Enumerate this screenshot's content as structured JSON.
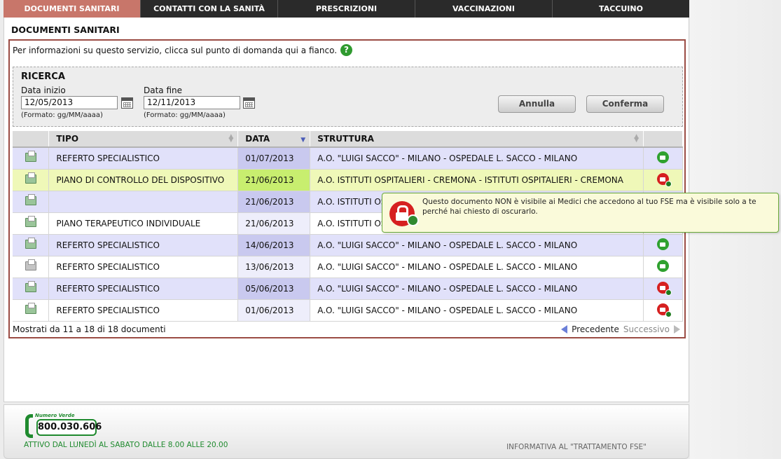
{
  "nav": {
    "tabs": [
      "DOCUMENTI SANITARI",
      "CONTATTI CON LA SANITÀ",
      "PRESCRIZIONI",
      "VACCINAZIONI",
      "TACCUINO"
    ]
  },
  "page": {
    "title": "DOCUMENTI SANITARI",
    "info_text": "Per informazioni su questo servizio, clicca sul punto di domanda qui a fianco."
  },
  "search": {
    "title": "RICERCA",
    "start_label": "Data inizio",
    "start_value": "12/05/2013",
    "start_format": "(Formato: gg/MM/aaaa)",
    "end_label": "Data fine",
    "end_value": "12/11/2013",
    "end_format": "(Formato: gg/MM/aaaa)",
    "cancel_label": "Annulla",
    "confirm_label": "Conferma"
  },
  "table": {
    "headers": [
      "",
      "TIPO",
      "DATA",
      "STRUTTURA",
      ""
    ],
    "rows": [
      {
        "tipo": "REFERTO SPECIALISTICO",
        "data": "01/07/2013",
        "struttura": "A.O. \"LUIGI SACCO\" - MILANO - OSPEDALE L. SACCO - MILANO"
      },
      {
        "tipo": "PIANO DI CONTROLLO DEL DISPOSITIVO",
        "data": "21/06/2013",
        "struttura": "A.O. ISTITUTI OSPITALIERI - CREMONA - ISTITUTI OSPITALIERI - CREMONA"
      },
      {
        "tipo": "",
        "data": "21/06/2013",
        "struttura": "A.O. ISTITUTI OS"
      },
      {
        "tipo": "PIANO TERAPEUTICO INDIVIDUALE",
        "data": "21/06/2013",
        "struttura": "A.O. ISTITUTI OS"
      },
      {
        "tipo": "REFERTO SPECIALISTICO",
        "data": "14/06/2013",
        "struttura": "A.O. \"LUIGI SACCO\" - MILANO - OSPEDALE L. SACCO - MILANO"
      },
      {
        "tipo": "REFERTO SPECIALISTICO",
        "data": "13/06/2013",
        "struttura": "A.O. \"LUIGI SACCO\" - MILANO - OSPEDALE L. SACCO - MILANO"
      },
      {
        "tipo": "REFERTO SPECIALISTICO",
        "data": "05/06/2013",
        "struttura": "A.O. \"LUIGI SACCO\" - MILANO - OSPEDALE L. SACCO - MILANO"
      },
      {
        "tipo": "REFERTO SPECIALISTICO",
        "data": "01/06/2013",
        "struttura": "A.O. \"LUIGI SACCO\" - MILANO - OSPEDALE L. SACCO - MILANO"
      }
    ]
  },
  "paging": {
    "summary": "Mostrati da 11 a 18 di 18 documenti",
    "prev_label": "Precedente",
    "next_label": "Successivo"
  },
  "tooltip": {
    "text": "Questo documento NON è visibile ai Medici che accedono al tuo FSE ma è visibile solo a te perché hai chiesto di oscurarlo."
  },
  "footer": {
    "phone_label": "Numero Verde",
    "phone_number": "800.030.606",
    "hours": "ATTIVO DAL LUNEDÌ AL SABATO DALLE 8.00 ALLE 20.00",
    "privacy_link": "INFORMATIVA AL \"TRATTAMENTO FSE\""
  },
  "colors": {
    "active_tab": "#c8766a",
    "panel_border": "#9b4c44",
    "highlight_row": "#eff8b8",
    "open_lock": "#2fa12f",
    "closed_lock": "#d62020"
  }
}
